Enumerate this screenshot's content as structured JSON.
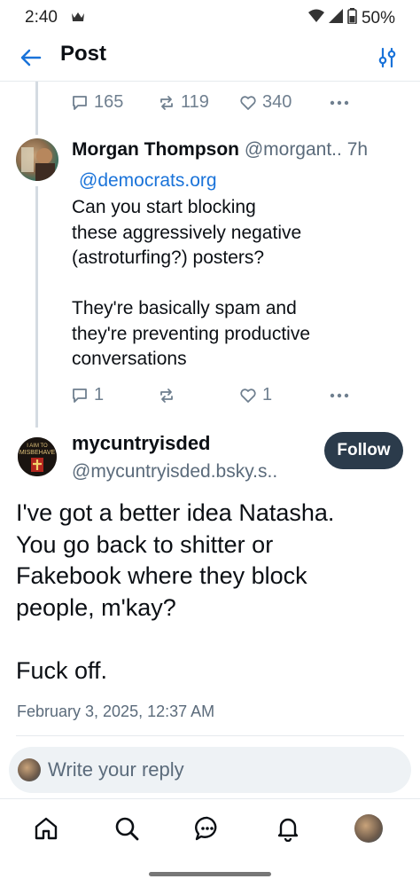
{
  "status_bar": {
    "time": "2:40",
    "battery": "50%"
  },
  "header": {
    "title": "Post"
  },
  "parent_post": {
    "replies": "165",
    "reposts": "119",
    "likes": "340"
  },
  "reply_post": {
    "author_name": "Morgan Thompson",
    "author_handle": "@morgant..",
    "time": "7h",
    "mention": "@democrats.org",
    "text": "Can you start blocking\nthese aggressively negative\n(astroturfing?) posters?\n\nThey're basically spam and\nthey're preventing productive\nconversations",
    "replies": "1",
    "reposts": "",
    "likes": "1"
  },
  "main_post": {
    "author_name": "mycuntryisded",
    "author_handle": "@mycuntryisded.bsky.s..",
    "avatar_text": "I AIM TO MISBEHAVE",
    "follow_label": "Follow",
    "text": "I've got a better idea Natasha.\nYou go back to shitter or\nFakebook where they block\npeople, m'kay?\n\nFuck off.",
    "date": "February 3, 2025, 12:37 AM"
  },
  "reply_bar": {
    "placeholder": "Write your reply"
  },
  "nav": {
    "items": [
      "home-icon",
      "search-icon",
      "chat-icon",
      "bell-icon",
      "profile-avatar"
    ]
  },
  "colors": {
    "accent": "#1a73d9",
    "follow_bg": "#2b3b4b",
    "muted": "#6f7f8f"
  }
}
